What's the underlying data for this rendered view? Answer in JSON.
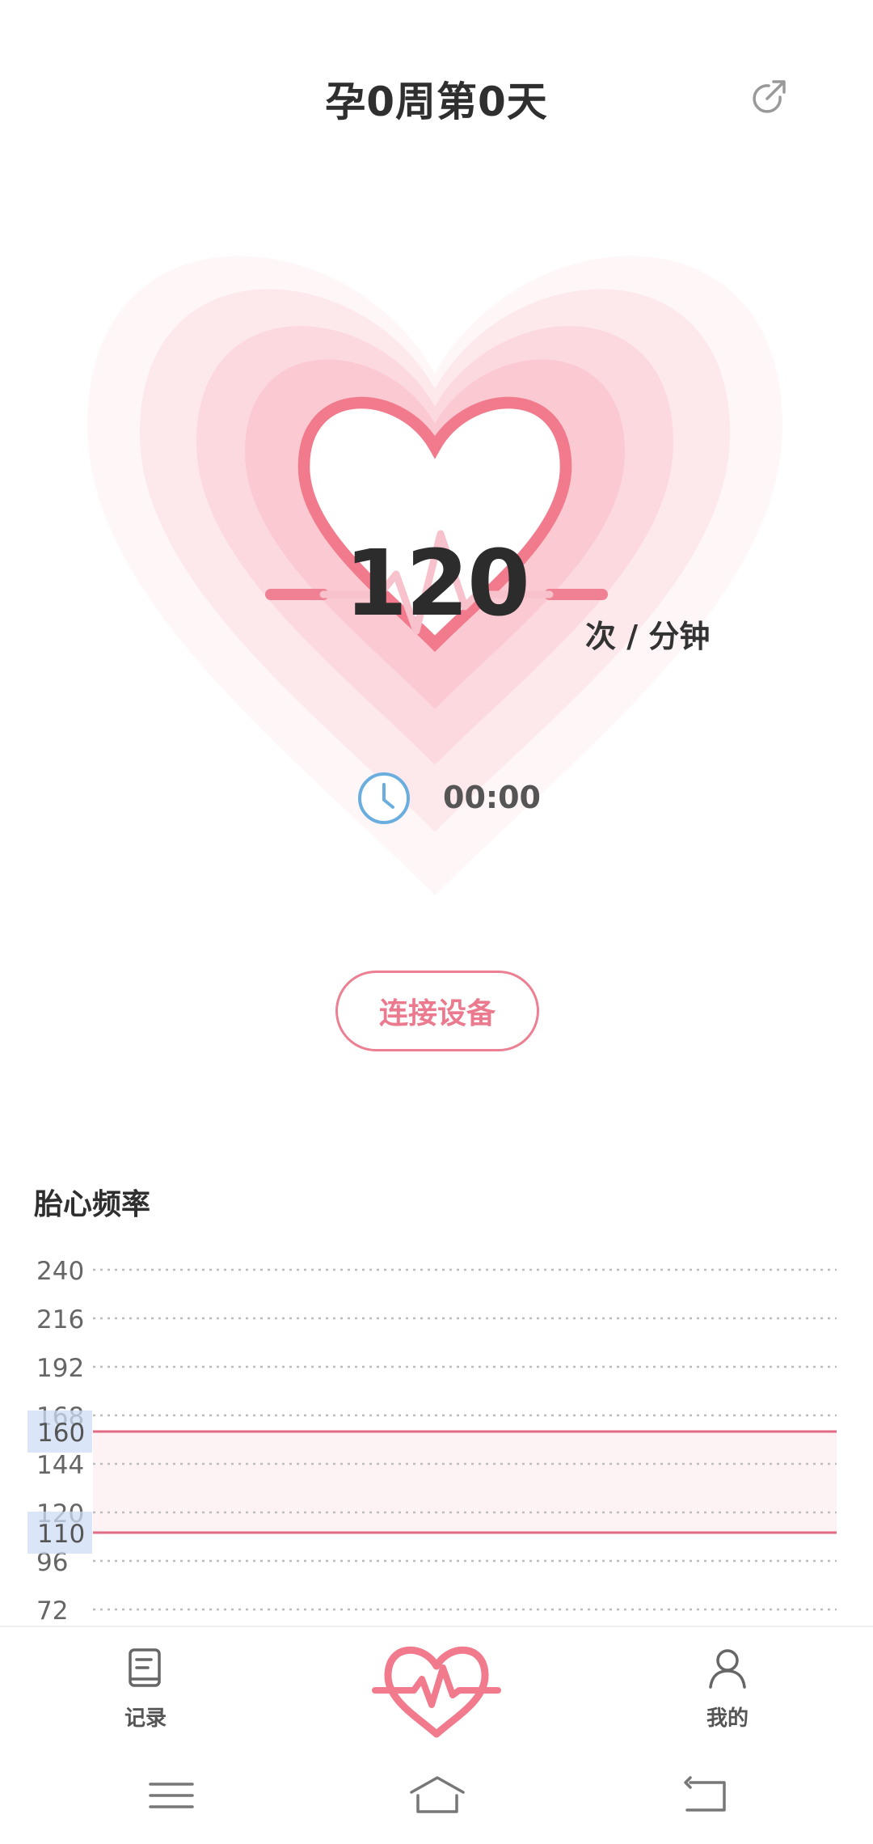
{
  "header": {
    "title": "孕0周第0天",
    "share_icon": "share-icon"
  },
  "hero": {
    "bpm_value": "120",
    "bpm_unit": "次 / 分钟",
    "timer": "00:00",
    "timer_icon": "clock-icon",
    "colors": {
      "heart_outline": "#f27a8d",
      "ring1": "#fde9ed",
      "ring2": "#fcd9df",
      "ring3": "#fbc7d0",
      "glow": "#fef5f7"
    }
  },
  "actions": {
    "connect_label": "连接设备"
  },
  "chart_section": {
    "title": "胎心频率"
  },
  "chart_data": {
    "type": "line",
    "title": "胎心频率",
    "y_ticks": [
      "240",
      "216",
      "192",
      "168",
      "144",
      "120",
      "96",
      "72"
    ],
    "y_tick_values": [
      240,
      216,
      192,
      168,
      144,
      120,
      96,
      72
    ],
    "ylim": [
      72,
      240
    ],
    "grid": "dotted horizontal",
    "reference_lines": [
      {
        "label": "160",
        "value": 160,
        "color": "#e26a82"
      },
      {
        "label": "110",
        "value": 110,
        "color": "#e26a82"
      }
    ],
    "normal_band": [
      110,
      160
    ],
    "series": []
  },
  "bottom_nav": {
    "items": [
      {
        "label": "记录",
        "icon": "book-icon"
      },
      {
        "label": "",
        "icon": "heartbeat-icon"
      },
      {
        "label": "我的",
        "icon": "user-icon"
      }
    ]
  },
  "system_nav": {
    "menu_icon": "menu-icon",
    "home_icon": "home-icon",
    "back_icon": "back-icon"
  }
}
